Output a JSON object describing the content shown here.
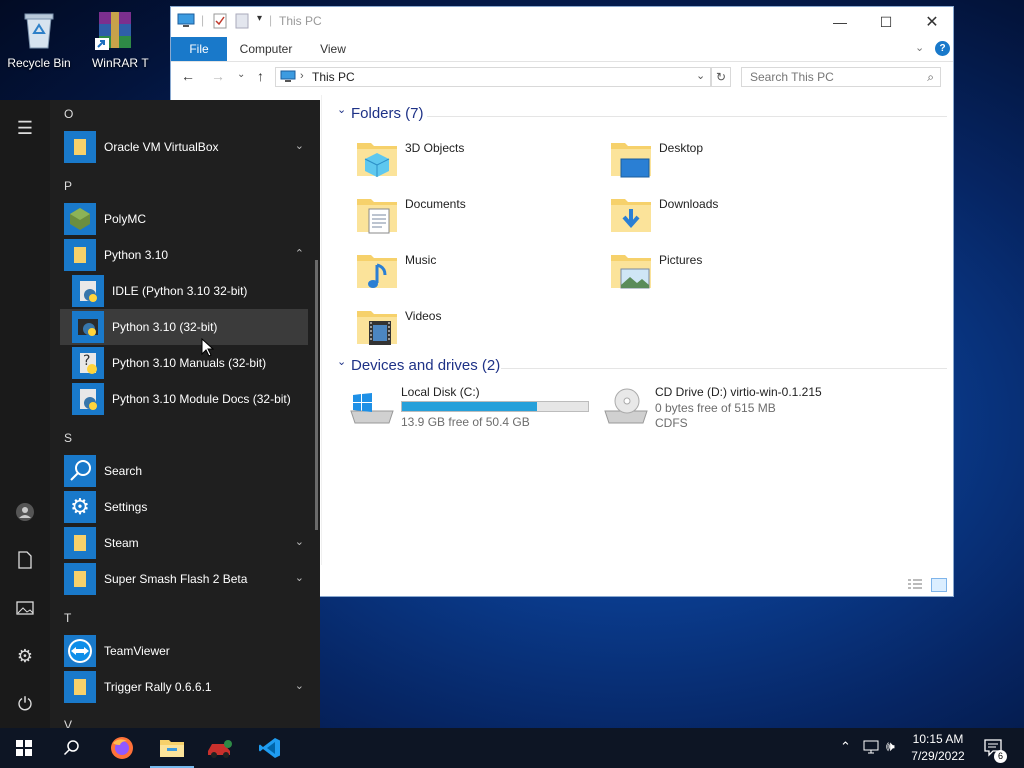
{
  "desktop": {
    "icons": [
      {
        "label": "Recycle Bin"
      },
      {
        "label": "WinRAR"
      },
      {
        "label": "T"
      }
    ]
  },
  "explorer": {
    "title": "This PC",
    "ribbon_tabs": [
      "File",
      "Computer",
      "View"
    ],
    "address": "This PC",
    "search_placeholder": "Search This PC",
    "folders_header": "Folders (7)",
    "folders": [
      "3D Objects",
      "Desktop",
      "Documents",
      "Downloads",
      "Music",
      "Pictures",
      "Videos"
    ],
    "drives_header": "Devices and drives (2)",
    "drives": [
      {
        "name": "Local Disk (C:)",
        "free": "13.9 GB free of 50.4 GB",
        "used_fraction": 0.724
      },
      {
        "name": "CD Drive (D:) virtio-win-0.1.215",
        "free": "0 bytes free of 515 MB",
        "fs": "CDFS"
      }
    ]
  },
  "start_menu": {
    "letters": [
      "O",
      "P",
      "S",
      "T",
      "V"
    ],
    "apps": [
      {
        "label": "Oracle VM VirtualBox",
        "expand": "⌄"
      },
      {
        "label": "PolyMC"
      },
      {
        "label": "Python 3.10",
        "expand": "⌃"
      },
      {
        "label": "IDLE (Python 3.10 32-bit)"
      },
      {
        "label": "Python 3.10 (32-bit)"
      },
      {
        "label": "Python 3.10 Manuals (32-bit)"
      },
      {
        "label": "Python 3.10 Module Docs (32-bit)"
      },
      {
        "label": "Search"
      },
      {
        "label": "Settings"
      },
      {
        "label": "Steam",
        "expand": "⌄"
      },
      {
        "label": "Super Smash Flash 2 Beta",
        "expand": "⌄"
      },
      {
        "label": "TeamViewer"
      },
      {
        "label": "Trigger Rally 0.6.6.1",
        "expand": "⌄"
      }
    ]
  },
  "taskbar": {
    "time": "10:15 AM",
    "date": "7/29/2022",
    "notification_count": "6"
  },
  "colors": {
    "accent": "#1979ca",
    "start_bg": "#1f1f1f",
    "taskbar_bg": "#0d1524",
    "section_header": "#1e3287",
    "drive_fill": "#26a0da"
  }
}
